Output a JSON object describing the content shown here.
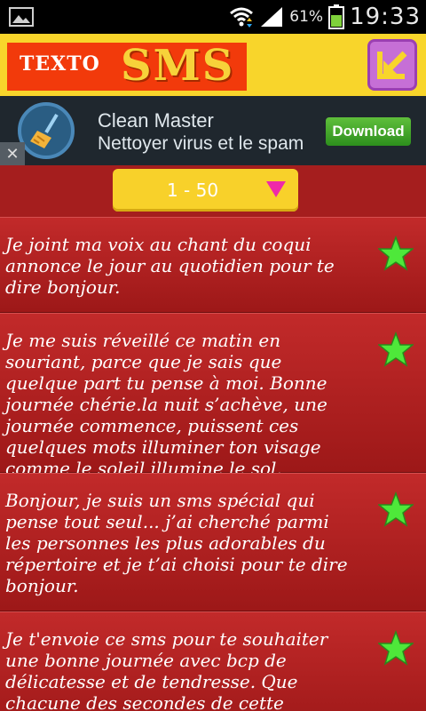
{
  "status_bar": {
    "battery_percent": "61%",
    "time": "19:33",
    "icons": [
      "gallery-icon",
      "wifi-icon",
      "signal-icon",
      "battery-icon"
    ]
  },
  "header": {
    "logo_part1": "TEXTO",
    "logo_part2": "SMS",
    "back_icon": "arrow-down-left-icon"
  },
  "ad": {
    "title": "Clean Master",
    "subtitle": "Nettoyer virus et le spam",
    "cta": "Download",
    "close": "✕",
    "icon": "broom-icon"
  },
  "filter": {
    "selected": "1 - 50"
  },
  "messages": [
    {
      "text": "Je joint ma voix au chant du coqui annonce le jour au quotidien pour te dire bonjour."
    },
    {
      "text": "Je me suis réveillé ce matin en souriant, parce que je sais que quelque part tu pense à moi. Bonne journée chérie.la nuit s’achève, une journée commence, puissent ces quelques mots illuminer ton visage comme le soleil illumine le sol."
    },
    {
      "text": "Bonjour, je suis un sms spécial qui pense tout seul... j’ai cherché parmi les personnes les plus adorables du répertoire et je t’ai choisi pour te dire bonjour."
    },
    {
      "text": "Je t'envoie ce sms pour te souhaiter une bonne journée avec bcp de délicatesse et de tendresse. Que chacune des secondes de cette journée soit un poème dont la"
    }
  ],
  "colors": {
    "header_bg": "#f8d52b",
    "list_bg": "#c22a2a",
    "star": "#4ee83a",
    "dropdown": "#f8d12a",
    "arrow": "#ef29a9"
  }
}
